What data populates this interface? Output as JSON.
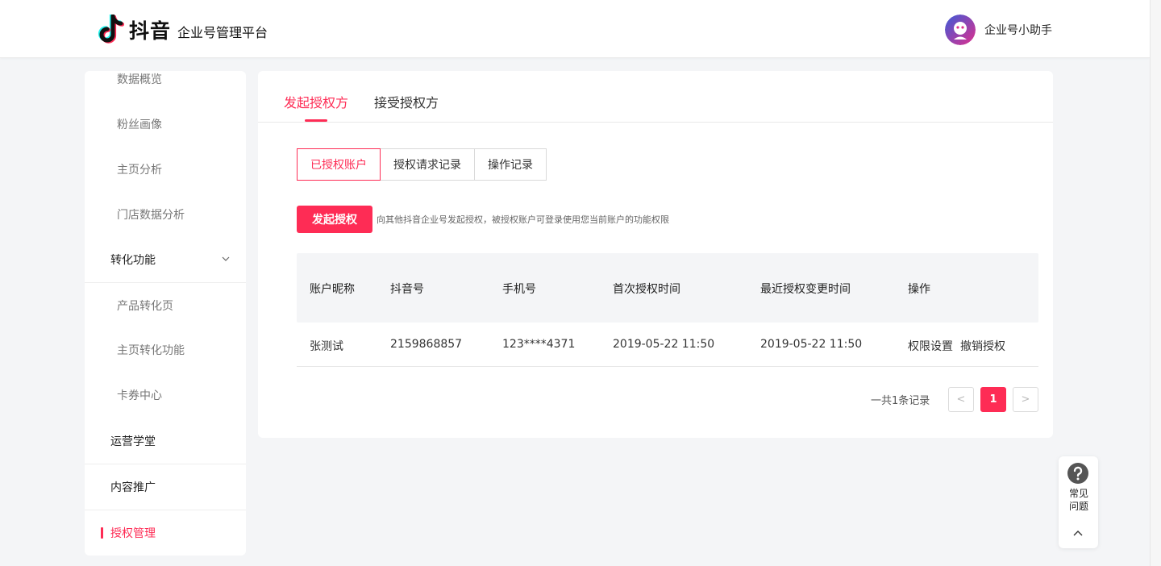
{
  "header": {
    "brand_name": "抖音",
    "platform_name": "企业号管理平台",
    "assistant_label": "企业号小助手"
  },
  "sidebar": {
    "items": [
      {
        "label": "数据概览",
        "type": "sub"
      },
      {
        "label": "粉丝画像",
        "type": "sub"
      },
      {
        "label": "主页分析",
        "type": "sub"
      },
      {
        "label": "门店数据分析",
        "type": "sub"
      },
      {
        "label": "转化功能",
        "type": "group",
        "expanded": true
      },
      {
        "label": "产品转化页",
        "type": "sub"
      },
      {
        "label": "主页转化功能",
        "type": "sub"
      },
      {
        "label": "卡券中心",
        "type": "sub"
      },
      {
        "label": "运营学堂",
        "type": "group"
      },
      {
        "label": "内容推广",
        "type": "group"
      },
      {
        "label": "授权管理",
        "type": "group",
        "active": true
      }
    ]
  },
  "tabs": [
    {
      "label": "发起授权方",
      "active": true
    },
    {
      "label": "接受授权方",
      "active": false
    }
  ],
  "segments": [
    {
      "label": "已授权账户",
      "active": true
    },
    {
      "label": "授权请求记录",
      "active": false
    },
    {
      "label": "操作记录",
      "active": false
    }
  ],
  "action": {
    "button_label": "发起授权",
    "hint": "向其他抖音企业号发起授权，被授权账户可登录使用您当前账户的功能权限"
  },
  "table": {
    "columns": [
      "账户昵称",
      "抖音号",
      "手机号",
      "首次授权时间",
      "最近授权变更时间",
      "操作"
    ],
    "rows": [
      {
        "nickname": "张测试",
        "douyin_id": "2159868857",
        "phone": "123****4371",
        "first_auth_time": "2019-05-22 11:50",
        "last_change_time": "2019-05-22 11:50",
        "actions": [
          "权限设置",
          "撤销授权"
        ]
      }
    ]
  },
  "pagination": {
    "total_text": "一共1条记录",
    "prev": "<",
    "current_page": "1",
    "next": ">"
  },
  "faq": {
    "label": "常见问题"
  },
  "colors": {
    "accent": "#fe2c55",
    "link": "#1e78e6",
    "page_bg": "#f4f5f7"
  }
}
